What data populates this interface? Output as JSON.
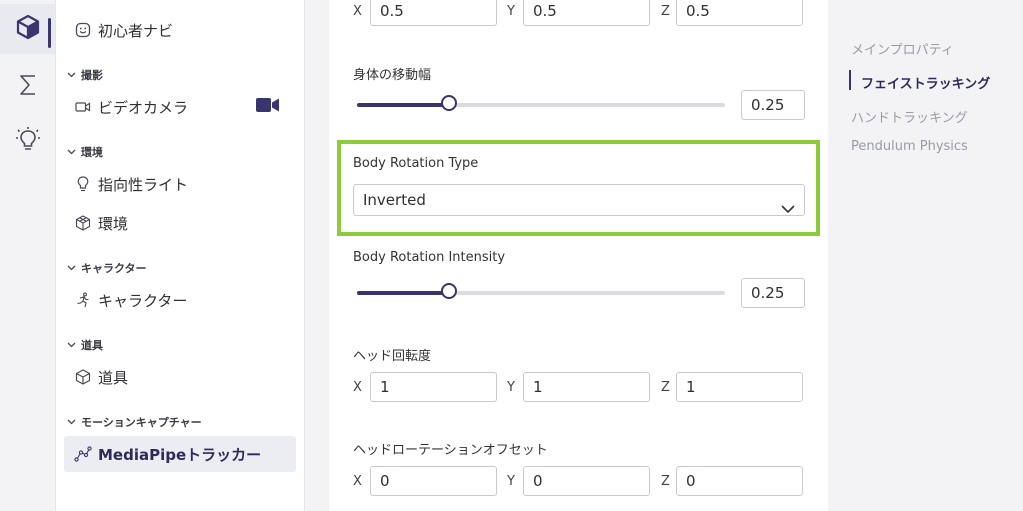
{
  "colors": {
    "accent": "#3a356e",
    "highlight": "#8ccc3a",
    "sidebar_bg": "#f3f3f6",
    "selected_bg": "#ececf3"
  },
  "rail": {
    "items": [
      {
        "icon": "cube-icon",
        "active": true
      },
      {
        "icon": "sigma-icon",
        "active": false
      },
      {
        "icon": "lightbulb-icon",
        "active": false
      }
    ]
  },
  "tree": {
    "beginner_nav": "初心者ナビ",
    "sections": {
      "camera": "撮影",
      "environment": "環境",
      "character": "キャラクター",
      "props": "道具",
      "motion_capture": "モーションキャプチャー"
    },
    "items": {
      "video_camera": "ビデオカメラ",
      "directional_light": "指向性ライト",
      "environment": "環境",
      "character": "キャラクター",
      "prop": "道具",
      "mediapipe_tracker": "MediaPipeトラッカー"
    }
  },
  "content": {
    "top_xyz": {
      "x_label": "X",
      "y_label": "Y",
      "z_label": "Z",
      "x": "0.5",
      "y": "0.5",
      "z": "0.5"
    },
    "body_move": {
      "label": "身体の移動幅",
      "value": "0.25",
      "fraction": 0.25
    },
    "rotation_type": {
      "label": "Body Rotation Type",
      "value": "Inverted"
    },
    "rotation_intensity": {
      "label": "Body Rotation Intensity",
      "value": "0.25",
      "fraction": 0.25
    },
    "head_rotation": {
      "label": "ヘッド回転度",
      "x_label": "X",
      "y_label": "Y",
      "z_label": "Z",
      "x": "1",
      "y": "1",
      "z": "1"
    },
    "head_offset": {
      "label": "ヘッドローテーションオフセット",
      "x_label": "X",
      "y_label": "Y",
      "z_label": "Z",
      "x": "0",
      "y": "0",
      "z": "0"
    }
  },
  "toc": {
    "items": [
      "メインプロパティ",
      "フェイストラッキング",
      "ハンドトラッキング",
      "Pendulum Physics"
    ],
    "active_index": 1
  }
}
